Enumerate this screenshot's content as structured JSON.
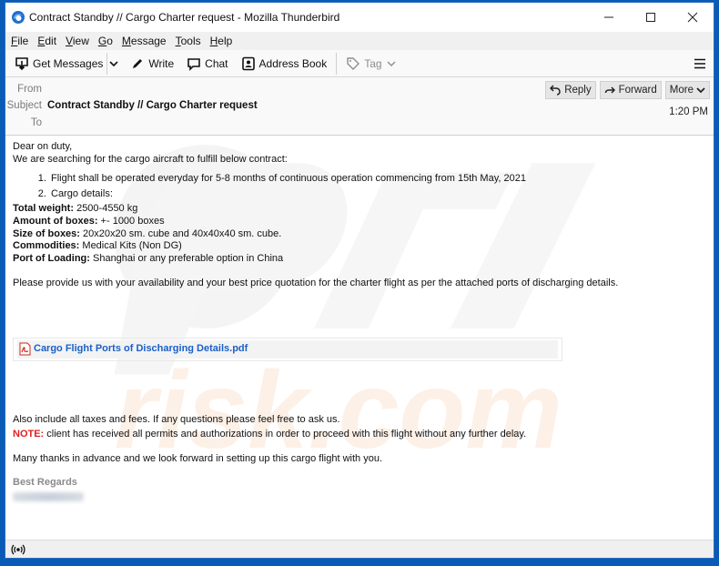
{
  "window": {
    "title": "Contract Standby // Cargo Charter request - Mozilla Thunderbird",
    "controls": [
      "minimize",
      "maximize",
      "close"
    ]
  },
  "menu": [
    {
      "label": "File",
      "accel": "F",
      "rest": "ile"
    },
    {
      "label": "Edit",
      "accel": "E",
      "rest": "dit"
    },
    {
      "label": "View",
      "accel": "V",
      "rest": "iew"
    },
    {
      "label": "Go",
      "accel": "G",
      "rest": "o"
    },
    {
      "label": "Message",
      "accel": "M",
      "rest": "essage"
    },
    {
      "label": "Tools",
      "accel": "T",
      "rest": "ools"
    },
    {
      "label": "Help",
      "accel": "H",
      "rest": "elp"
    }
  ],
  "toolbar": {
    "get_messages": "Get Messages",
    "write": "Write",
    "chat": "Chat",
    "address_book": "Address Book",
    "tag": "Tag"
  },
  "header": {
    "from_label": "From",
    "subject_label": "Subject",
    "to_label": "To",
    "subject": "Contract Standby // Cargo Charter request",
    "time": "1:20 PM",
    "reply": "Reply",
    "forward": "Forward",
    "more": "More"
  },
  "body": {
    "greeting": "Dear on duty,",
    "intro": "We are searching for the cargo aircraft to fulfill below contract:",
    "list": [
      "Flight shall be operated everyday for 5-8 months of continuous operation commencing from 15th May, 2021",
      "Cargo details:"
    ],
    "details": [
      {
        "label": "Total weight:",
        "value": " 2500-4550 kg"
      },
      {
        "label": "Amount of boxes:",
        "value": " +- 1000 boxes"
      },
      {
        "label": "Size of boxes:",
        "value": " 20x20x20 sm. cube and 40x40x40 sm. cube."
      },
      {
        "label": "Commodities:",
        "value": " Medical Kits (Non DG)"
      },
      {
        "label": "Port of Loading:",
        "value": " Shanghai or any preferable option in China"
      }
    ],
    "request": "Please provide us with your availability and your best price quotation for the charter flight as per the attached ports of discharging details.",
    "attachment": "Cargo Flight Ports of Discharging Details.pdf",
    "taxes": "Also include all taxes and fees. If any questions please feel free to ask us.",
    "note_label": "NOTE:",
    "note_text": " client has received all permits and authorizations in order to proceed with this flight without any further delay.",
    "thanks": "Many thanks in advance and we look forward in setting up this cargo flight with you.",
    "regards": "Best Regards"
  },
  "colors": {
    "accent_blue": "#1a5fc8",
    "note_red": "#e02020",
    "frame_blue": "#0a5bb5"
  }
}
